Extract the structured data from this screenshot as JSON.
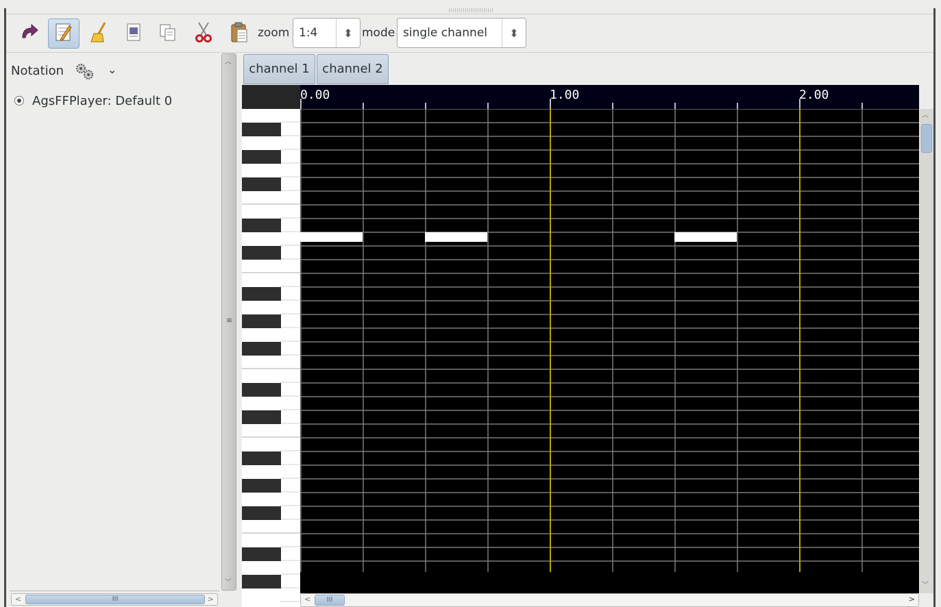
{
  "toolbar": {
    "buttons": [
      {
        "name": "redo-icon",
        "glyph": "↷"
      },
      {
        "name": "edit-pencil-icon",
        "glyph": "✎"
      },
      {
        "name": "clear-broom-icon",
        "glyph": "🧹"
      },
      {
        "name": "select-all-icon",
        "glyph": "▤"
      },
      {
        "name": "copy-icon",
        "glyph": "⧉"
      },
      {
        "name": "cut-scissors-icon",
        "glyph": "✂"
      },
      {
        "name": "paste-icon",
        "glyph": "📋"
      }
    ],
    "zoom_label": "zoom",
    "zoom_value": "1:4",
    "mode_label": "mode",
    "mode_value": "single channel"
  },
  "left_panel": {
    "title": "Notation",
    "player": "AgsFFPlayer: Default 0"
  },
  "tabs": [
    "channel 1",
    "channel 2"
  ],
  "ruler": {
    "labels": [
      "0.00",
      "1.00",
      "2.00"
    ]
  },
  "notes": [
    {
      "row": 9,
      "start": 0,
      "end": 1
    },
    {
      "row": 9,
      "start": 2,
      "end": 3
    },
    {
      "row": 9,
      "start": 6,
      "end": 7
    }
  ],
  "colors": {
    "grid_bg": "#000000",
    "grid_line": "#7a7a7a",
    "beat_line": "#b6a800",
    "note": "#ffffff",
    "accent": "#a9c0da"
  },
  "scrollbars": {
    "thumb_grip": "III"
  }
}
